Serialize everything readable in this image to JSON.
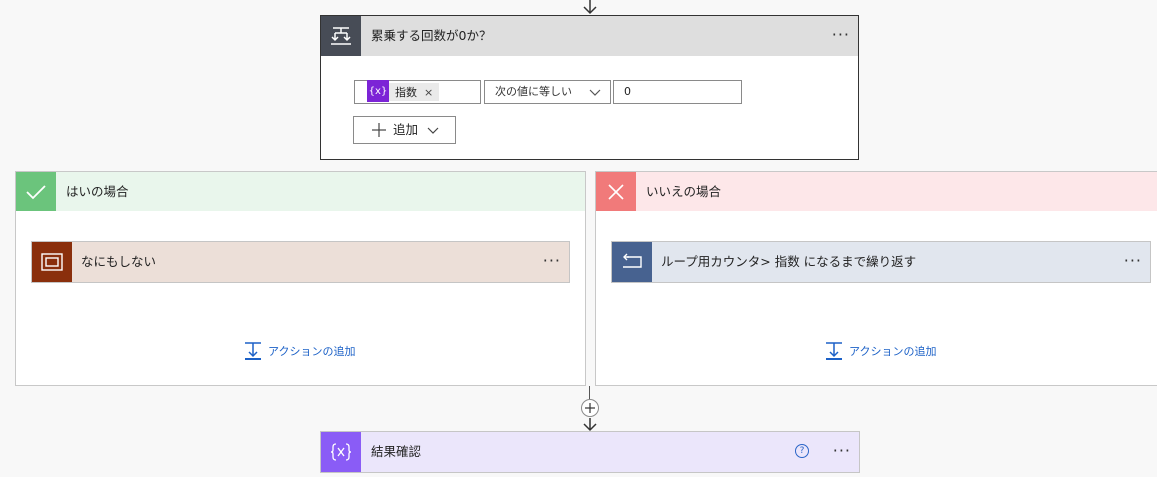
{
  "condition": {
    "title": "累乗する回数が0か？",
    "menu": "···",
    "token_label": "指数",
    "token_icon_text": "{x}",
    "token_remove": "×",
    "operator": "次の値に等しい",
    "value": "0",
    "add_label": "追加"
  },
  "yes_branch": {
    "title": "はいの場合",
    "action_title": "なにもしない",
    "action_menu": "···",
    "add_action": "アクションの追加"
  },
  "no_branch": {
    "title": "いいえの場合",
    "action_title": "ループ用カウンタ> 指数 になるまで繰り返す",
    "action_menu": "···",
    "add_action": "アクションの追加"
  },
  "result": {
    "title": "結果確認",
    "help": "?",
    "menu": "···"
  },
  "colors": {
    "token_purple": "#7c24d6",
    "yes_green": "#6bc47c",
    "no_red": "#f17a7a",
    "scope_brown": "#8a2f0c",
    "loop_blue": "#476290",
    "variable_purple": "#8a5cf6",
    "link_blue": "#1c61c7"
  }
}
